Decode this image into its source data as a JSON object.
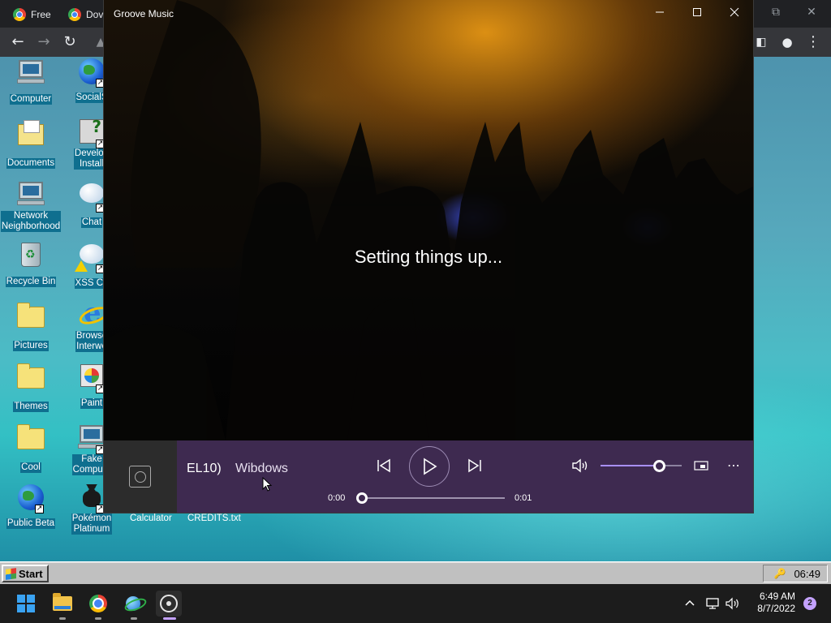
{
  "browser": {
    "tabs": [
      {
        "label": "Free"
      },
      {
        "label": "Dov"
      }
    ]
  },
  "desktop": {
    "icons_col1": [
      {
        "label": "Computer",
        "icon": "computer-icon"
      },
      {
        "label": "Documents",
        "icon": "documents-icon"
      },
      {
        "label": "Network\nNeighborhood",
        "icon": "network-neighborhood-icon"
      },
      {
        "label": "Recycle Bin",
        "icon": "recycle-bin-icon"
      },
      {
        "label": "Pictures",
        "icon": "folder-icon"
      },
      {
        "label": "Themes",
        "icon": "folder-icon"
      },
      {
        "label": "Cool",
        "icon": "folder-icon"
      },
      {
        "label": "Public Beta",
        "icon": "globe-icon"
      }
    ],
    "icons_col2": [
      {
        "label": "SocialS",
        "icon": "globe-icon"
      },
      {
        "label": "Develop\nInstall",
        "icon": "setup-icon"
      },
      {
        "label": "Chat",
        "icon": "chat-icon"
      },
      {
        "label": "XSS Ch",
        "icon": "chat-warning-icon"
      },
      {
        "label": "Browse\nInterwe",
        "icon": "internet-explorer-icon"
      },
      {
        "label": "Paint",
        "icon": "paint-icon"
      },
      {
        "label": "Fake\nCompute",
        "icon": "computer-icon"
      },
      {
        "label": "Pokémon\nPlatinum",
        "icon": "pokemon-icon"
      }
    ],
    "bottom_labels": [
      "Calculator",
      "CREDITS.txt"
    ]
  },
  "retro_taskbar": {
    "start_label": "Start",
    "clock": "06:49"
  },
  "groove": {
    "window_title": "Groove Music",
    "status": "Setting things up...",
    "track_title": "EL10)",
    "artist": "Wibdows",
    "time_elapsed": "0:00",
    "time_total": "0:01",
    "progress_fraction": 0.0,
    "volume_fraction": 0.72,
    "accent": "#3e2a50"
  },
  "taskbar": {
    "time": "6:49 AM",
    "date": "8/7/2022",
    "notification_count": "2",
    "accent": "#c4a2ff"
  }
}
